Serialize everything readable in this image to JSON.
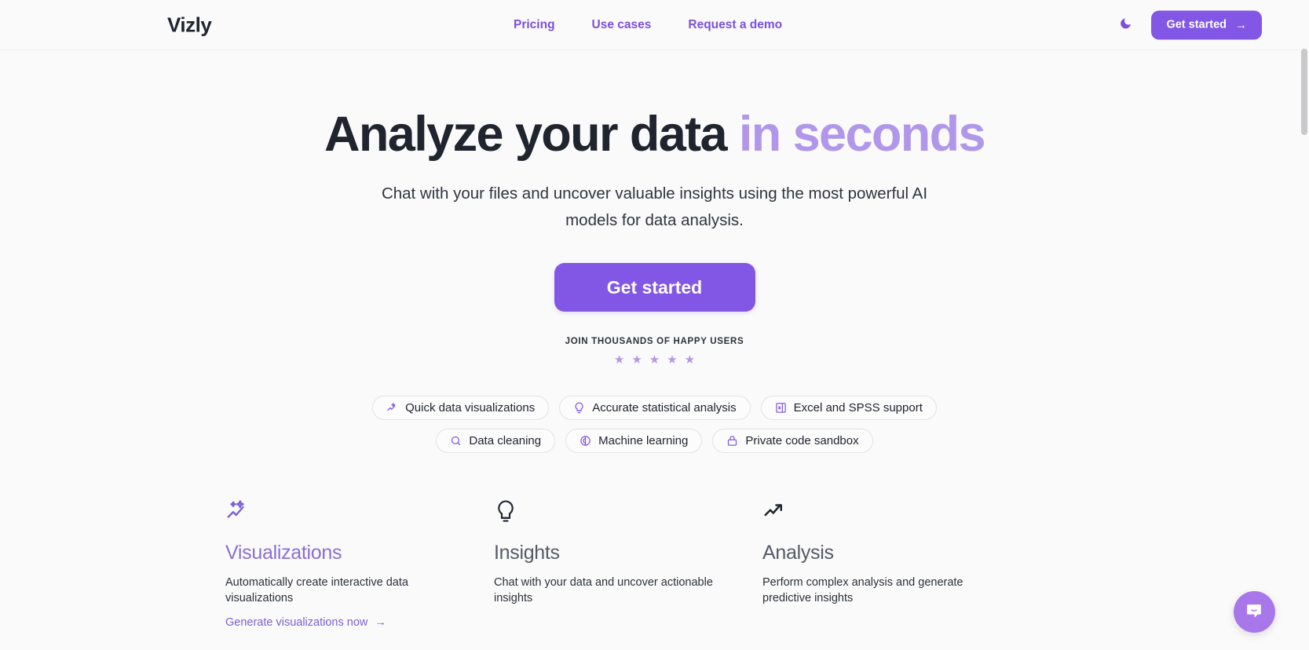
{
  "header": {
    "logo": "Vizly",
    "nav": [
      {
        "label": "Pricing",
        "name": "nav-pricing"
      },
      {
        "label": "Use cases",
        "name": "nav-use-cases"
      },
      {
        "label": "Request a demo",
        "name": "nav-request-demo"
      }
    ],
    "theme_toggle_icon": "moon-icon",
    "cta_label": "Get started",
    "cta_arrow": "→"
  },
  "hero": {
    "headline_main": "Analyze your data ",
    "headline_accent": "in seconds",
    "subheading": "Chat with your files and uncover valuable insights using the most powerful AI models for data analysis.",
    "cta_label": "Get started",
    "social_label": "JOIN THOUSANDS OF HAPPY USERS",
    "star_glyph": "★",
    "star_count": 5
  },
  "pills": {
    "row1": [
      {
        "label": "Quick data visualizations",
        "icon": "sparkle-chart-icon"
      },
      {
        "label": "Accurate statistical analysis",
        "icon": "lightbulb-icon"
      },
      {
        "label": "Excel and SPSS support",
        "icon": "spreadsheet-icon"
      }
    ],
    "row2": [
      {
        "label": "Data cleaning",
        "icon": "search-icon"
      },
      {
        "label": "Machine learning",
        "icon": "brain-icon"
      },
      {
        "label": "Private code sandbox",
        "icon": "lock-icon"
      }
    ]
  },
  "features": [
    {
      "title": "Visualizations",
      "description": "Automatically create interactive data visualizations",
      "link_label": "Generate visualizations now",
      "link_arrow": "→",
      "icon": "sparkle-chart-icon",
      "active": true
    },
    {
      "title": "Insights",
      "description": "Chat with your data and uncover actionable insights",
      "icon": "lightbulb-icon",
      "active": false
    },
    {
      "title": "Analysis",
      "description": "Perform complex analysis and generate predictive insights",
      "icon": "trending-up-icon",
      "active": false
    }
  ],
  "chat": {
    "icon": "chat-bubble-smile-icon"
  },
  "colors": {
    "brand_purple": "#8257e5",
    "accent_light_purple": "#b197ea",
    "nav_purple": "#7c4fe0",
    "text_dark": "#20242e",
    "background": "#fafafa"
  }
}
